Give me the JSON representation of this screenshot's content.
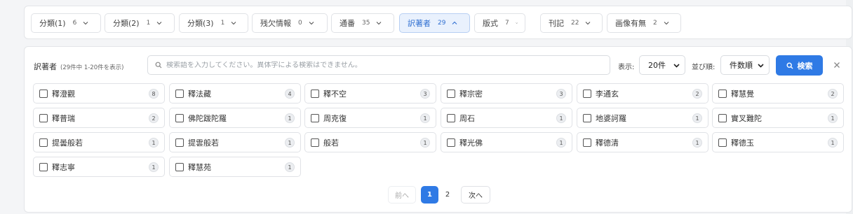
{
  "facets": [
    {
      "label": "分類(1)",
      "count": "6",
      "active": false
    },
    {
      "label": "分類(2)",
      "count": "1",
      "active": false
    },
    {
      "label": "分類(3)",
      "count": "1",
      "active": false
    },
    {
      "label": "残欠情報",
      "count": "0",
      "active": false
    },
    {
      "label": "通番",
      "count": "35",
      "active": false
    },
    {
      "label": "訳著者",
      "count": "29",
      "active": true
    },
    {
      "label": "版式",
      "count": "7",
      "active": false
    },
    {
      "label": "刊記",
      "count": "22",
      "active": false
    },
    {
      "label": "画像有無",
      "count": "2",
      "active": false
    }
  ],
  "panel": {
    "title": "訳著者",
    "subtitle": "(29件中 1-20件を表示)",
    "search_placeholder": "検索語を入力してください。異体字による検索はできません。",
    "display_label": "表示:",
    "display_value": "20件",
    "sort_label": "並び順:",
    "sort_value": "件数順",
    "search_button": "検索"
  },
  "options": [
    {
      "name": "釋澄觀",
      "count": "8"
    },
    {
      "name": "釋法藏",
      "count": "4"
    },
    {
      "name": "釋不空",
      "count": "3"
    },
    {
      "name": "釋宗密",
      "count": "3"
    },
    {
      "name": "李通玄",
      "count": "2"
    },
    {
      "name": "釋慧覺",
      "count": "2"
    },
    {
      "name": "釋普瑞",
      "count": "2"
    },
    {
      "name": "佛陀跋陀羅",
      "count": "1"
    },
    {
      "name": "周克復",
      "count": "1"
    },
    {
      "name": "周石",
      "count": "1"
    },
    {
      "name": "地婆訶羅",
      "count": "1"
    },
    {
      "name": "實叉難陀",
      "count": "1"
    },
    {
      "name": "提曇般若",
      "count": "1"
    },
    {
      "name": "提雲般若",
      "count": "1"
    },
    {
      "name": "般若",
      "count": "1"
    },
    {
      "name": "釋光佛",
      "count": "1"
    },
    {
      "name": "釋德清",
      "count": "1"
    },
    {
      "name": "釋德玉",
      "count": "1"
    },
    {
      "name": "釋志寧",
      "count": "1"
    },
    {
      "name": "釋慧苑",
      "count": "1"
    }
  ],
  "pagination": {
    "prev": "前へ",
    "pages": [
      "1",
      "2"
    ],
    "current": "1",
    "next": "次へ"
  },
  "colors": {
    "accent": "#2f7ae5",
    "active_bg": "#e9f1fd"
  }
}
